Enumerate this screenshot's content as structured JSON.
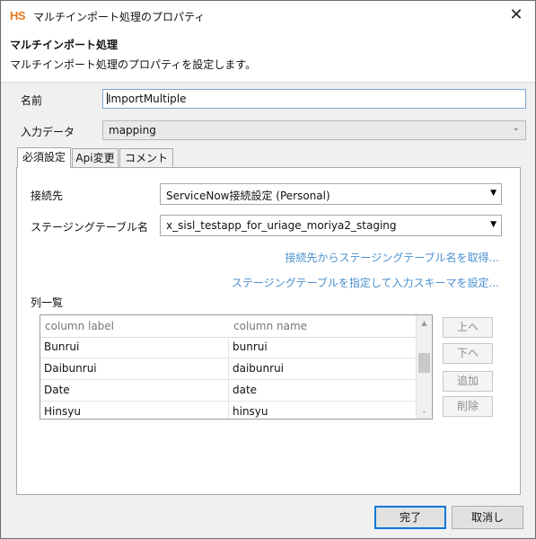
{
  "window": {
    "logo": "HS",
    "title": "マルチインポート処理のプロパティ"
  },
  "header": {
    "title": "マルチインポート処理",
    "description": "マルチインポート処理のプロパティを設定します。"
  },
  "form": {
    "name_label": "名前",
    "name_value": "ImportMultiple",
    "input_data_label": "入力データ",
    "input_data_value": "mapping"
  },
  "tabs": [
    {
      "label": "必須設定",
      "active": true
    },
    {
      "label": "Api変更",
      "active": false
    },
    {
      "label": "コメント",
      "active": false
    }
  ],
  "required": {
    "connection_label": "接続先",
    "connection_value": "ServiceNow接続設定 (Personal)",
    "staging_label": "ステージングテーブル名",
    "staging_value": "x_sisl_testapp_for_uriage_moriya2_staging",
    "link_fetch": "接続先からステージングテーブル名を取得...",
    "link_schema": "ステージングテーブルを指定して入力スキーマを設定...",
    "list_label": "列一覧"
  },
  "columns_table": {
    "headers": [
      "column label",
      "column name"
    ],
    "rows": [
      [
        "Bunrui",
        "bunrui"
      ],
      [
        "Daibunrui",
        "daibunrui"
      ],
      [
        "Date",
        "date"
      ],
      [
        "Hinsyu",
        "hinsyu"
      ]
    ]
  },
  "side_buttons": {
    "up": "上へ",
    "down": "下へ",
    "add": "追加",
    "delete": "削除"
  },
  "footer": {
    "ok": "完了",
    "cancel": "取消し"
  },
  "colors": {
    "accent": "#0078d7",
    "link": "#4b8fd0",
    "logo": "#e6781e"
  }
}
